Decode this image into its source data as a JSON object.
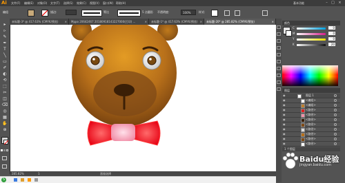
{
  "menubar": {
    "logo": "Ai",
    "items": [
      "文件(F)",
      "编辑(E)",
      "对象(O)",
      "文字(T)",
      "选择(S)",
      "效果(C)",
      "视图(V)",
      "窗口(W)",
      "帮助(H)"
    ],
    "workspace": "基本功能",
    "win_controls": [
      "–",
      "□",
      "×"
    ]
  },
  "ctrlbar": {
    "selection_label": "编组",
    "stroke_label": "描边:",
    "stroke_weight": "",
    "profile_label": "等比",
    "brush_label": "5 点圆形",
    "opacity_label": "不透明度:",
    "opacity_value": "100%",
    "style_label": "样式:",
    "fill_color": "#c8aa7a"
  },
  "tabs": [
    {
      "label": "未标题-3* @ 417.63% (CMYK/预览)",
      "active": false
    },
    {
      "label": "Mppo 20642467 20180918143227000(打印) ...",
      "active": false
    },
    {
      "label": "未标题-1* @ 417.63% (CMYK/预览)",
      "active": false
    },
    {
      "label": "未标题-20* @ 285.82% (CMYK/预览)",
      "active": true
    }
  ],
  "status": {
    "zoom": "285.82%",
    "page": "1",
    "tool": "直接选择"
  },
  "panel": {
    "color_title": "颜色",
    "sliders": [
      {
        "label": "C",
        "value": "0",
        "color": "#00a0e0"
      },
      {
        "label": "M",
        "value": "0",
        "color": "#d81b8a"
      },
      {
        "label": "Y",
        "value": "0",
        "color": "#f0e000"
      },
      {
        "label": "K",
        "value": "20",
        "color": "#333333"
      }
    ],
    "layers_title": "图层",
    "layers": [
      {
        "name": "图层 1"
      },
      {
        "name": "<编组>"
      },
      {
        "name": "<编组>"
      },
      {
        "name": "<路径>"
      },
      {
        "name": "<路径>"
      },
      {
        "name": "<路径>"
      },
      {
        "name": "<路径>"
      },
      {
        "name": "<路径>"
      },
      {
        "name": "<路径>"
      },
      {
        "name": "<路径>"
      },
      {
        "name": "<路径>"
      }
    ],
    "layer_count": "1 个图层"
  },
  "watermark": {
    "brand": "Baidu经验",
    "url": "jingyan.baidu.com"
  },
  "taskbar": {
    "start_label": "S"
  },
  "tools": [
    "▸",
    "▹",
    "✎",
    "✒",
    "T",
    "╲",
    "▭",
    "✐",
    "◐",
    "⟲",
    "⬚",
    "✂",
    "◫",
    "⌫",
    "◎",
    "▦",
    "✋",
    "⊕"
  ]
}
